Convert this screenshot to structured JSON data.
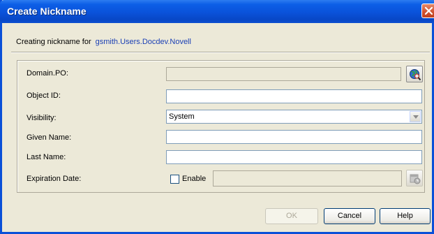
{
  "window": {
    "title": "Create Nickname"
  },
  "header": {
    "prefix": "Creating nickname for",
    "object_name": "gsmith.Users.Docdev.Novell"
  },
  "form": {
    "domain_po": {
      "label": "Domain.PO:",
      "value": ""
    },
    "object_id": {
      "label": "Object ID:",
      "value": ""
    },
    "visibility": {
      "label": "Visibility:",
      "selected": "System"
    },
    "given_name": {
      "label": "Given Name:",
      "value": ""
    },
    "last_name": {
      "label": "Last Name:",
      "value": ""
    },
    "expiration_date": {
      "label": "Expiration Date:",
      "enable_label": "Enable",
      "enabled": false,
      "value": ""
    }
  },
  "buttons": {
    "ok": "OK",
    "cancel": "Cancel",
    "help": "Help"
  }
}
